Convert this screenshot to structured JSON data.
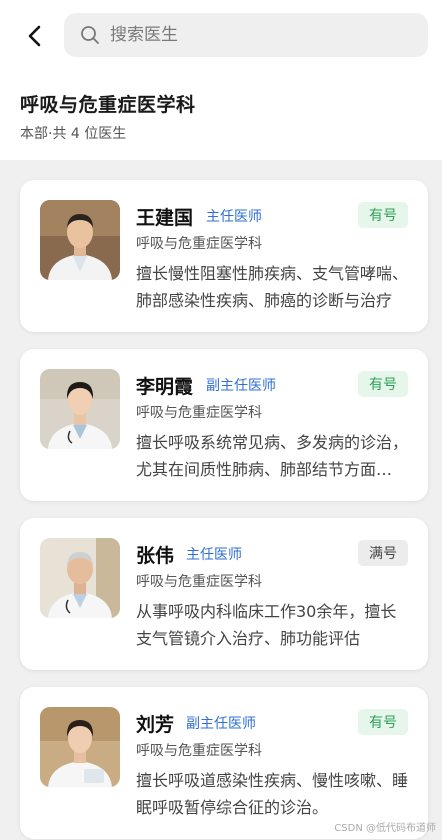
{
  "search": {
    "placeholder": "搜索医生"
  },
  "department": {
    "name": "呼吸与危重症医学科",
    "summary": "本部·共 4 位医生"
  },
  "doctors": [
    {
      "name": "王建国",
      "title": "主任医师",
      "dept": "呼吸与危重症医学科",
      "status": "有号",
      "status_type": "available",
      "desc": "擅长慢性阻塞性肺疾病、支气管哮喘、肺部感染性疾病、肺癌的诊断与治疗"
    },
    {
      "name": "李明霞",
      "title": "副主任医师",
      "dept": "呼吸与危重症医学科",
      "status": "有号",
      "status_type": "available",
      "desc": "擅长呼吸系统常见病、多发病的诊治，尤其在间质性肺病、肺部结节方面经验丰富"
    },
    {
      "name": "张伟",
      "title": "主任医师",
      "dept": "呼吸与危重症医学科",
      "status": "满号",
      "status_type": "full",
      "desc": "从事呼吸内科临床工作30余年，擅长支气管镜介入治疗、肺功能评估"
    },
    {
      "name": "刘芳",
      "title": "副主任医师",
      "dept": "呼吸与危重症医学科",
      "status": "有号",
      "status_type": "available",
      "desc": "擅长呼吸道感染性疾病、慢性咳嗽、睡眠呼吸暂停综合征的诊治。"
    }
  ],
  "watermark": "CSDN @低代码布道师",
  "colors": {
    "title_blue": "#2f6fd6",
    "available_green": "#2ea05a",
    "available_bg": "#e6f6ea",
    "full_bg": "#ececec"
  },
  "icons": {
    "back": "chevron-left-icon",
    "search": "search-icon"
  }
}
